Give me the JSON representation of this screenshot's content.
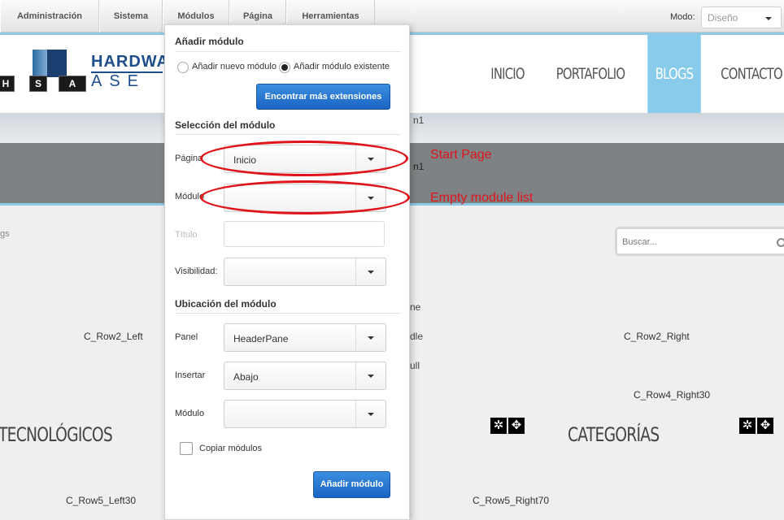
{
  "toolbar": {
    "menu": [
      {
        "label": "Administración"
      },
      {
        "label": "Sistema"
      },
      {
        "label": "Módulos"
      },
      {
        "label": "Página"
      },
      {
        "label": "Herramientas"
      }
    ],
    "mode_label": "Modo:",
    "mode_value": "Diseño"
  },
  "site": {
    "logo": {
      "line1": "HARDWA",
      "line2": "ASE",
      "pads": [
        "H",
        "S",
        "A"
      ]
    },
    "nav": [
      {
        "label": "INICIO",
        "active": false
      },
      {
        "label": "PORTAFOLIO",
        "active": false
      },
      {
        "label": "BLOGS",
        "active": true
      },
      {
        "label": "CONTACTO",
        "active": false
      }
    ],
    "banner_peek_1": "n1",
    "banner_peek_2": "n1",
    "breadcrumb": "gs",
    "search_placeholder": "Buscar..."
  },
  "panes": {
    "row2_left": "C_Row2_Left",
    "row2_right": "C_Row2_Right",
    "row4_right30": "C_Row4_Right30",
    "row5_left30": "C_Row5_Left30",
    "row5_right70": "C_Row5_Right70",
    "peek_ne": "ne",
    "peek_dle": "dle",
    "peek_ull": "ull"
  },
  "headings": {
    "left": "TECNOLÓGICOS",
    "right": "CATEGORÍAS"
  },
  "panel": {
    "title": "Añadir módulo",
    "radio_new": "Añadir nuevo módulo",
    "radio_existing": "Añadir módulo existente",
    "radio_selected": "existing",
    "find_extensions": "Encontrar más extensiones",
    "selection_title": "Selección del módulo",
    "page_label": "Página",
    "page_value": "Inicio",
    "module_label": "Módulo",
    "module_value": "",
    "title_label": "Título",
    "title_value": "",
    "visibility_label": "Visibilidad:",
    "visibility_value": "",
    "location_title": "Ubicación del módulo",
    "pane_label": "Panel",
    "pane_value": "HeaderPane",
    "insert_label": "Insertar",
    "insert_value": "Abajo",
    "module2_label": "Módulo",
    "module2_value": "",
    "copy_label": "Copiar módulos",
    "copy_checked": false,
    "add_button": "Añadir módulo"
  },
  "annotations": {
    "start_page": "Start Page",
    "empty_list": "Empty module list",
    "color": "#e0141b"
  },
  "colors": {
    "accent_blue": "#88cbea",
    "button_blue": "#1b64c3",
    "banner_dark": "#7f8284"
  }
}
